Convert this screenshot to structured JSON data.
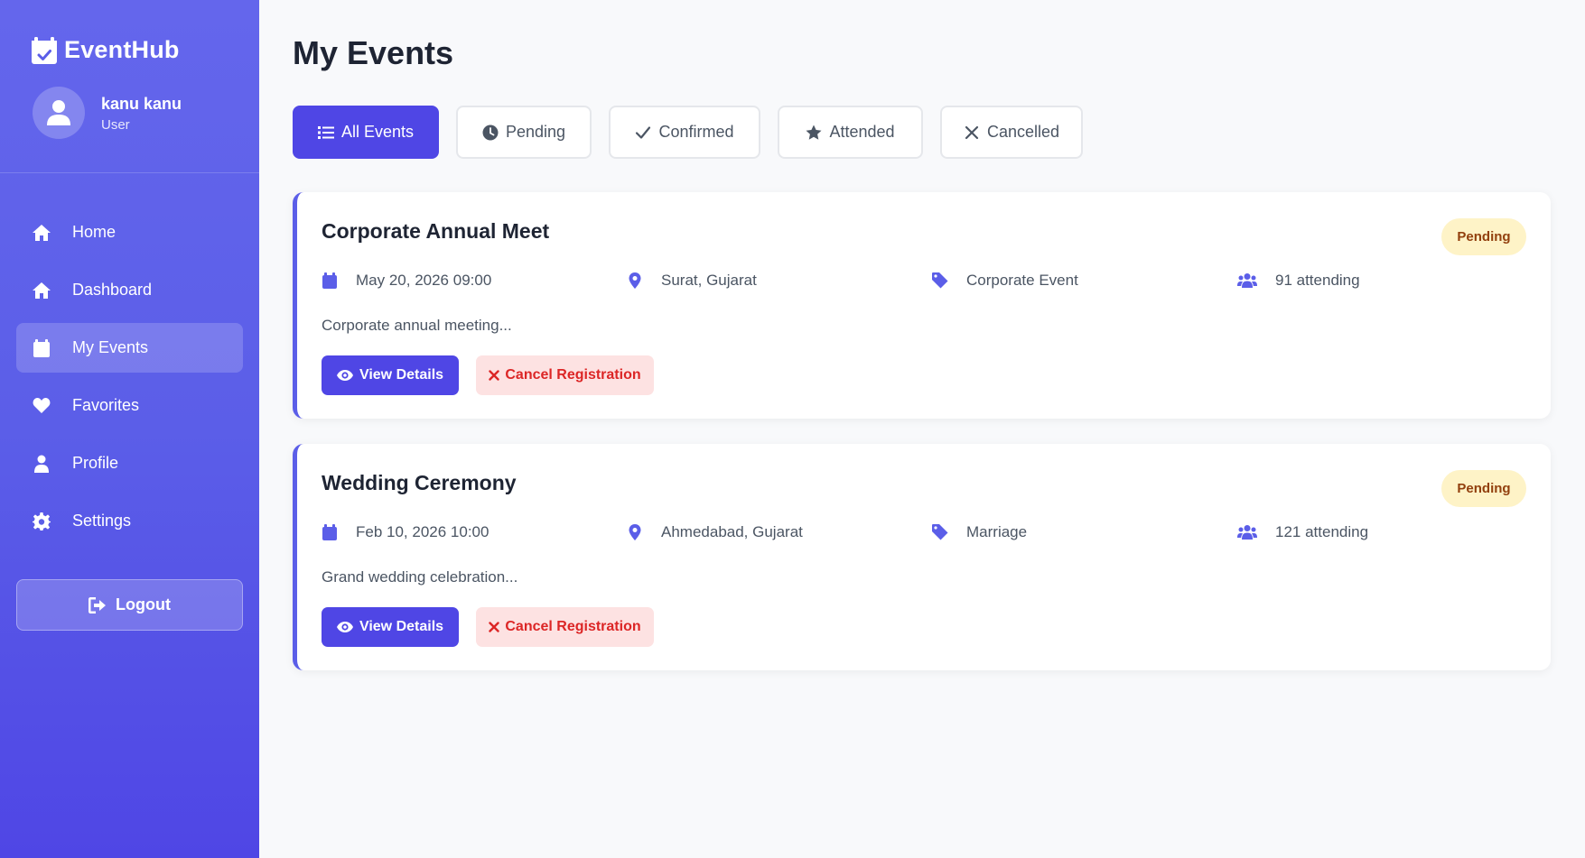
{
  "brand": {
    "name": "EventHub"
  },
  "user": {
    "name": "kanu kanu",
    "role": "User"
  },
  "nav": [
    {
      "label": "Home",
      "icon": "home-icon"
    },
    {
      "label": "Dashboard",
      "icon": "home-icon"
    },
    {
      "label": "My Events",
      "icon": "calendar-icon",
      "active": true
    },
    {
      "label": "Favorites",
      "icon": "heart-icon"
    },
    {
      "label": "Profile",
      "icon": "user-icon"
    },
    {
      "label": "Settings",
      "icon": "gear-icon"
    }
  ],
  "logout_label": "Logout",
  "page_title": "My Events",
  "tabs": [
    {
      "label": "All Events",
      "icon": "list-icon",
      "active": true
    },
    {
      "label": "Pending",
      "icon": "clock-icon"
    },
    {
      "label": "Confirmed",
      "icon": "check-icon"
    },
    {
      "label": "Attended",
      "icon": "star-icon"
    },
    {
      "label": "Cancelled",
      "icon": "x-icon"
    }
  ],
  "events": [
    {
      "title": "Corporate Annual Meet",
      "status": "Pending",
      "date": "May 20, 2026 09:00",
      "location": "Surat, Gujarat",
      "category": "Corporate Event",
      "attending": "91 attending",
      "description": "Corporate annual meeting...",
      "view_label": "View Details",
      "cancel_label": "Cancel Registration"
    },
    {
      "title": "Wedding Ceremony",
      "status": "Pending",
      "date": "Feb 10, 2026 10:00",
      "location": "Ahmedabad, Gujarat",
      "category": "Marriage",
      "attending": "121 attending",
      "description": "Grand wedding celebration...",
      "view_label": "View Details",
      "cancel_label": "Cancel Registration"
    }
  ],
  "colors": {
    "primary": "#4f46e5",
    "sidebar": "#5b5ee8",
    "badge_bg": "#fef3c7",
    "badge_text": "#92400e",
    "danger": "#dc2626"
  }
}
